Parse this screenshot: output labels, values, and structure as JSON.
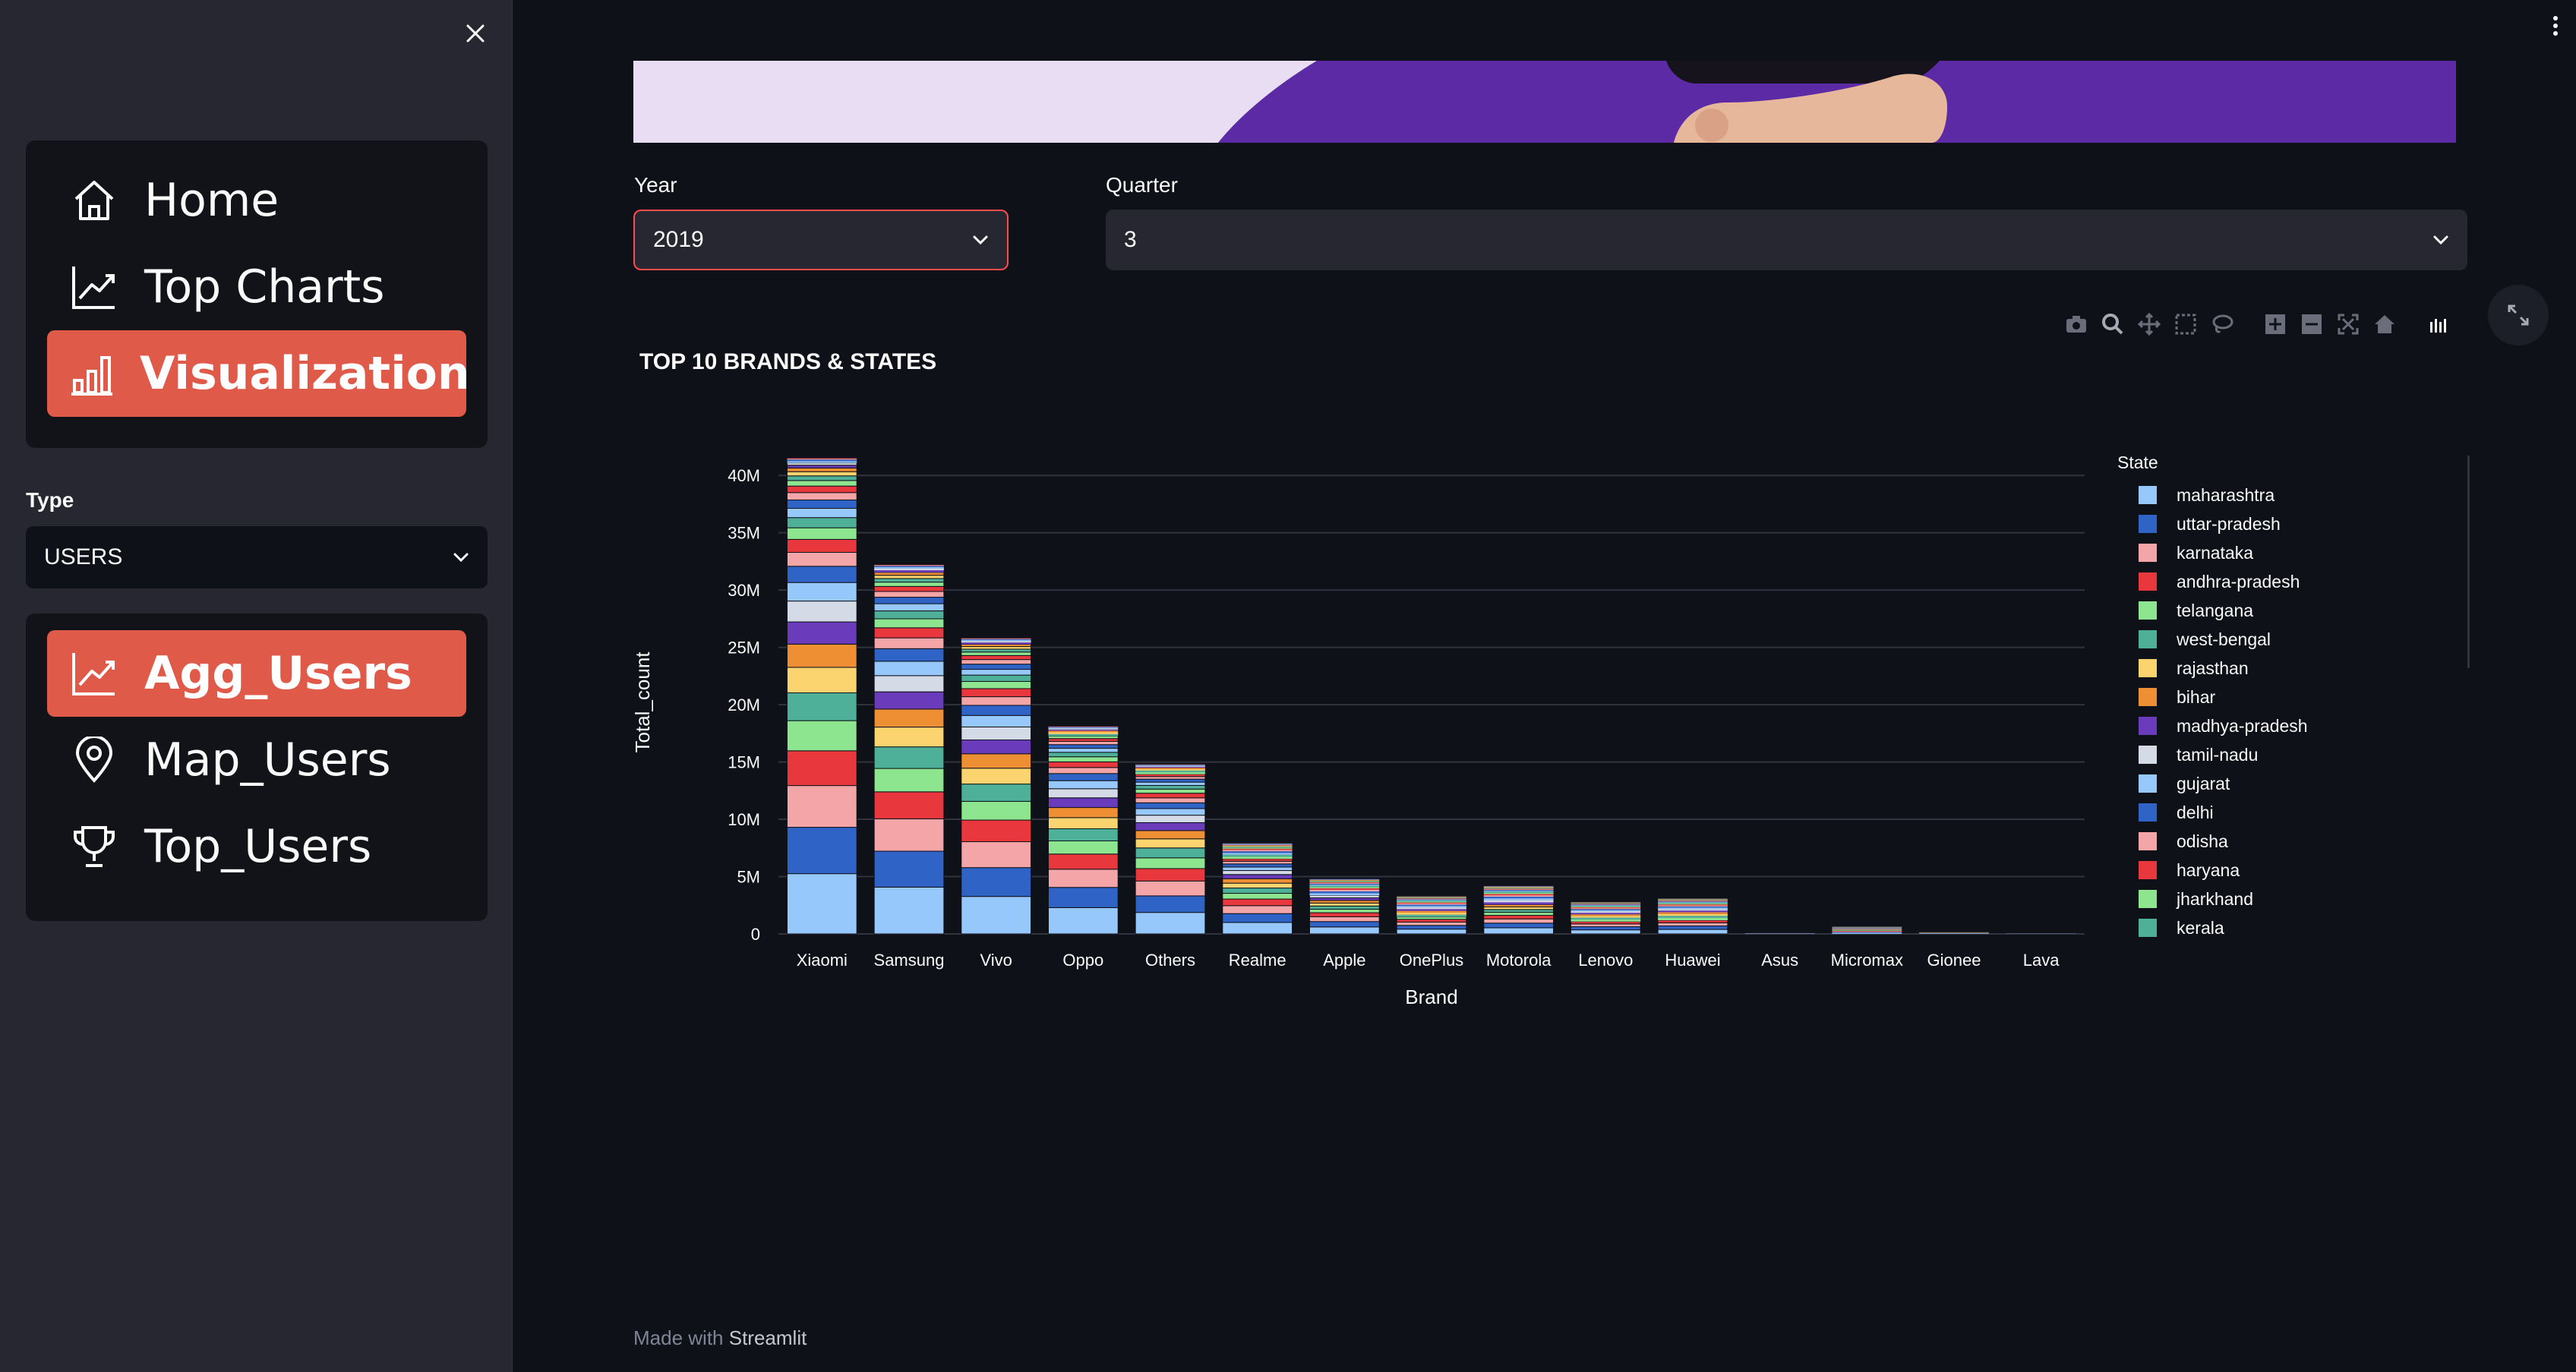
{
  "sidebar": {
    "nav": [
      {
        "label": "Home",
        "icon": "home-icon",
        "active": false
      },
      {
        "label": "Top Charts",
        "icon": "trend-chart-icon",
        "active": false
      },
      {
        "label": "Visualization",
        "icon": "bar-chart-icon",
        "active": true
      }
    ],
    "type_label": "Type",
    "type_value": "USERS",
    "sub_nav": [
      {
        "label": "Agg_Users",
        "icon": "trend-chart-icon",
        "active": true
      },
      {
        "label": "Map_Users",
        "icon": "map-pin-icon",
        "active": false
      },
      {
        "label": "Top_Users",
        "icon": "trophy-icon",
        "active": false
      }
    ]
  },
  "filters": {
    "year_label": "Year",
    "year_value": "2019",
    "quarter_label": "Quarter",
    "quarter_value": "3"
  },
  "chart_title": "TOP 10 BRANDS & STATES",
  "footer": {
    "prefix": "Made with",
    "brand": "Streamlit"
  },
  "colors": {
    "accent": "#e05a4a",
    "banner": "#5b2aa4"
  },
  "chart_data": {
    "type": "bar",
    "stacked": true,
    "title": "TOP 10 BRANDS & STATES",
    "xlabel": "Brand",
    "ylabel": "Total_count",
    "ylim": [
      0,
      42000000
    ],
    "yticks": [
      0,
      5000000,
      10000000,
      15000000,
      20000000,
      25000000,
      30000000,
      35000000,
      40000000
    ],
    "ytick_labels": [
      "0",
      "5M",
      "10M",
      "15M",
      "20M",
      "25M",
      "30M",
      "35M",
      "40M"
    ],
    "categories": [
      "Xiaomi",
      "Samsung",
      "Vivo",
      "Oppo",
      "Others",
      "Realme",
      "Apple",
      "OnePlus",
      "Motorola",
      "Lenovo",
      "Huawei",
      "Asus",
      "Micromax",
      "Gionee",
      "Lava"
    ],
    "totals": [
      41500000,
      32200000,
      25800000,
      18100000,
      14800000,
      7900000,
      4800000,
      3300000,
      4200000,
      2800000,
      3100000,
      180000,
      700000,
      250000,
      120000
    ],
    "legend_title": "State",
    "legend_position": "right",
    "series": [
      {
        "name": "maharashtra",
        "color": "#97c8fb"
      },
      {
        "name": "uttar-pradesh",
        "color": "#2f64c6"
      },
      {
        "name": "karnataka",
        "color": "#f4a5a8"
      },
      {
        "name": "andhra-pradesh",
        "color": "#e8383d"
      },
      {
        "name": "telangana",
        "color": "#8de58f"
      },
      {
        "name": "west-bengal",
        "color": "#4fb09a"
      },
      {
        "name": "rajasthan",
        "color": "#fbd46f"
      },
      {
        "name": "bihar",
        "color": "#ef8f33"
      },
      {
        "name": "madhya-pradesh",
        "color": "#6a3cbc"
      },
      {
        "name": "tamil-nadu",
        "color": "#d5dbe6"
      },
      {
        "name": "gujarat",
        "color": "#97c8fb"
      },
      {
        "name": "delhi",
        "color": "#2f64c6"
      },
      {
        "name": "odisha",
        "color": "#f4a5a8"
      },
      {
        "name": "haryana",
        "color": "#e8383d"
      },
      {
        "name": "jharkhand",
        "color": "#8de58f"
      },
      {
        "name": "kerala",
        "color": "#4fb09a"
      }
    ],
    "state_shares": [
      0.13,
      0.1,
      0.09,
      0.075,
      0.065,
      0.06,
      0.055,
      0.05,
      0.048,
      0.045,
      0.04,
      0.035,
      0.03,
      0.028,
      0.025,
      0.022,
      0.02,
      0.018,
      0.016,
      0.014,
      0.012,
      0.01,
      0.009,
      0.008,
      0.006,
      0.005,
      0.004,
      0.003,
      0.002,
      0.001
    ]
  }
}
